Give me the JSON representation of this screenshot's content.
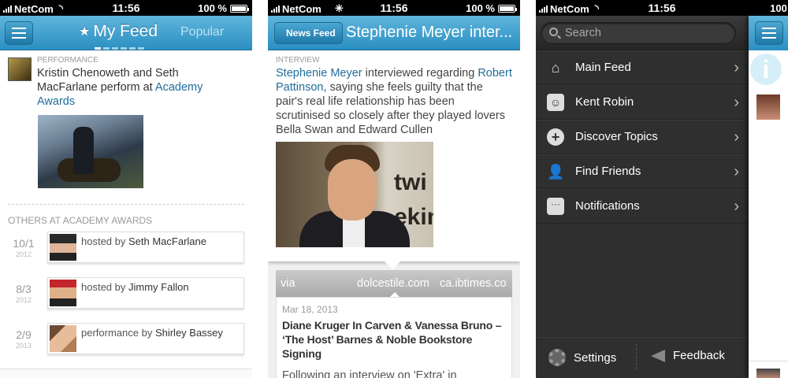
{
  "status_bar": {
    "carrier": "NetCom",
    "time": "11:56",
    "battery": "100 %"
  },
  "screen1": {
    "tabs": {
      "active": "My Feed",
      "other": "Popular"
    },
    "story": {
      "category": "PERFORMANCE",
      "person1": "Kristin Chenoweth",
      "and": " and ",
      "person2": "Seth MacFarlane",
      "perform_at": " perform at ",
      "event": "Academy Awards"
    },
    "others_header": "OTHERS AT ACADEMY AWARDS",
    "rows": [
      {
        "date": "10/1",
        "year": "2012",
        "prefix": "hosted by ",
        "name": "Seth MacFarlane"
      },
      {
        "date": "8/3",
        "year": "2012",
        "prefix": "hosted by ",
        "name": "Jimmy Fallon"
      },
      {
        "date": "2/9",
        "year": "2013",
        "prefix": "performance by ",
        "name": "Shirley Bassey"
      }
    ]
  },
  "screen2": {
    "back_label": "News Feed",
    "title": "Stephenie Meyer inter...",
    "article": {
      "category": "INTERVIEW",
      "link1": "Stephenie Meyer",
      "text1": " interviewed regarding ",
      "link2": "Robert Pattinson",
      "text2": ", saying she feels guilty that the pair's real life relationship has been scrutinised so closely after they played lovers Bella Swan and Edward Cullen",
      "photo_text": "twi\nekin"
    },
    "via": {
      "label": "via",
      "active": "dolcestile.com",
      "next": "ca.ibtimes.co"
    },
    "source": {
      "date": "Mar 18, 2013",
      "title": "Diane Kruger In Carven & Vanessa Bruno – ‘The Host’ Barnes & Noble Bookstore Signing",
      "excerpt": "Following an interview on 'Extra' in"
    }
  },
  "screen3": {
    "search_placeholder": "Search",
    "menu": [
      {
        "label": "Main Feed",
        "icon": "home-icon"
      },
      {
        "label": "Kent Robin",
        "icon": "profile-icon"
      },
      {
        "label": "Discover Topics",
        "icon": "plus-icon"
      },
      {
        "label": "Find Friends",
        "icon": "add-friend-icon"
      },
      {
        "label": "Notifications",
        "icon": "chat-bubble-icon"
      }
    ],
    "settings": "Settings",
    "feedback": "Feedback",
    "peek_info": "i"
  }
}
